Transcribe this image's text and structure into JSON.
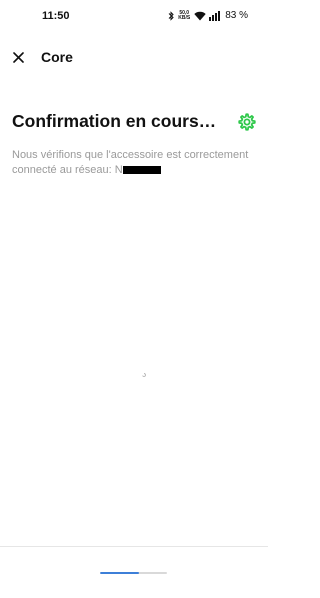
{
  "status_bar": {
    "time": "11:50",
    "net_speed_value": "50,0",
    "net_speed_unit": "KB/S",
    "battery": "83 %",
    "icons": [
      "bluetooth-icon",
      "wifi-icon",
      "signal-icon",
      "battery-icon"
    ]
  },
  "app_bar": {
    "title": "Core",
    "close_icon": "close-icon"
  },
  "main": {
    "heading": "Confirmation en cours…",
    "description": "Nous vérifions que l'accessoire est correctement connecté au réseau: N",
    "settings_icon": "gear-icon"
  },
  "footer": {
    "progress": 0.58
  },
  "colors": {
    "accent_green": "#2ec84a",
    "progress_blue": "#3d7fd8",
    "muted_text": "#9a9a9a"
  }
}
